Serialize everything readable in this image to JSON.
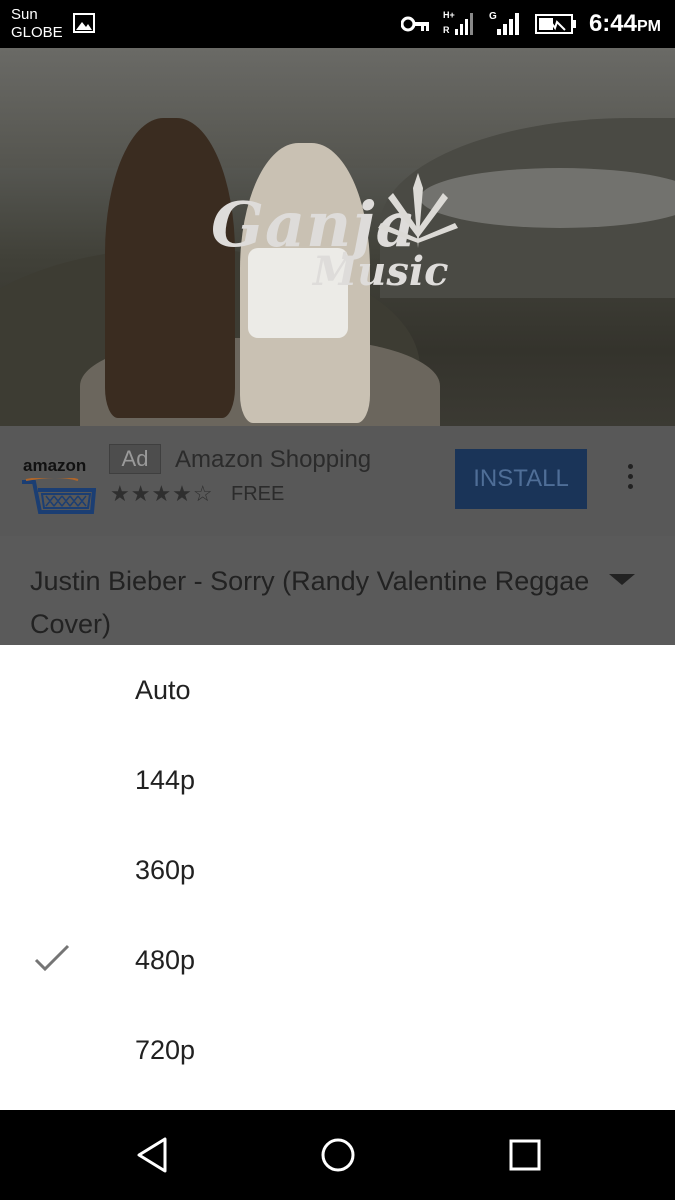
{
  "status_bar": {
    "carrier_line1": "Sun",
    "carrier_line2": "GLOBE",
    "time": "6:44",
    "time_suffix": "PM",
    "icons": [
      "gallery-icon",
      "vpn-key-icon",
      "signal-icon",
      "signal-icon",
      "battery-icon"
    ],
    "network_labels": [
      "H+",
      "R",
      "G"
    ]
  },
  "video": {
    "logo_text_1": "Ganja",
    "logo_text_2": "Music"
  },
  "ad": {
    "brand_word": "amazon",
    "badge": "Ad",
    "title": "Amazon Shopping",
    "rating": 4,
    "rating_max": 5,
    "stars_text": "★★★★☆",
    "price": "FREE",
    "install_label": "INSTALL",
    "accent_color": "#1a3458"
  },
  "video_title": "Justin Bieber - Sorry (Randy Valentine Reggae Cover)",
  "quality_options": [
    {
      "label": "Auto",
      "selected": false
    },
    {
      "label": "144p",
      "selected": false
    },
    {
      "label": "360p",
      "selected": false
    },
    {
      "label": "480p",
      "selected": true
    },
    {
      "label": "720p",
      "selected": false
    }
  ],
  "nav": {
    "icons": [
      "back-icon",
      "home-icon",
      "recents-icon"
    ]
  }
}
